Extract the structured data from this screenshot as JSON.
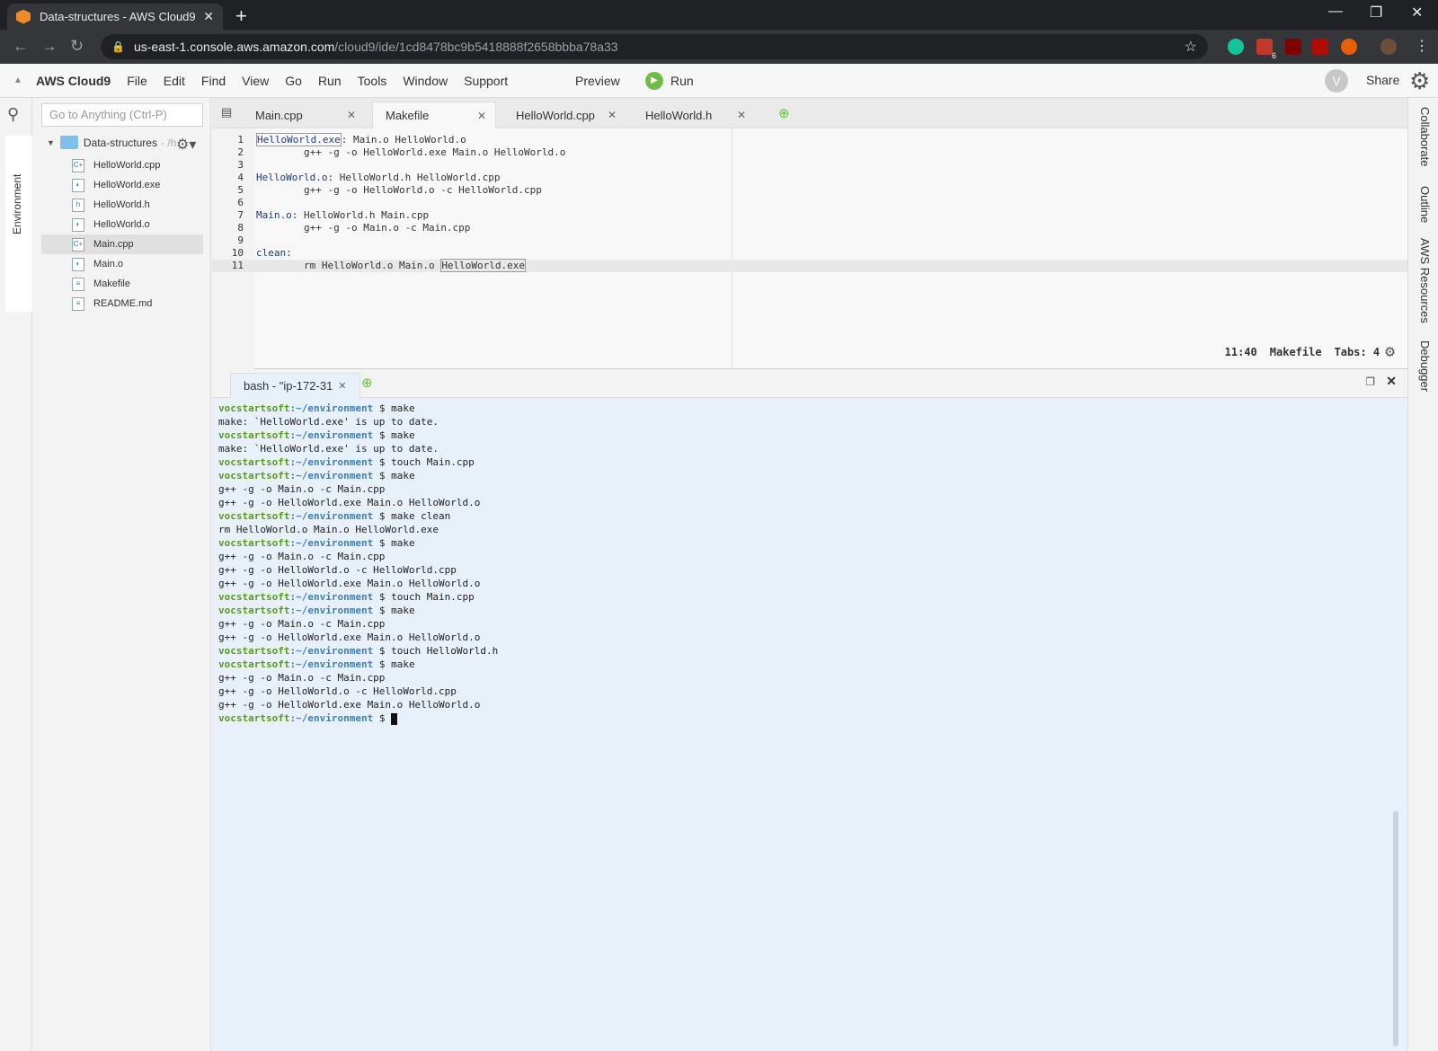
{
  "browser": {
    "tab_title": "Data-structures - AWS Cloud9",
    "new_tab": "+",
    "url_host": "us-east-1.console.aws.amazon.com",
    "url_path": "/cloud9/ide/1cd8478bc9b5418888f2658bbba78a33",
    "ext_badge": "6"
  },
  "menubar": {
    "brand": "AWS Cloud9",
    "items": [
      "File",
      "Edit",
      "Find",
      "View",
      "Go",
      "Run",
      "Tools",
      "Window",
      "Support"
    ],
    "preview": "Preview",
    "run": "Run",
    "avatar": "V",
    "share": "Share"
  },
  "left": {
    "environment_label": "Environment",
    "goto_placeholder": "Go to Anything (Ctrl-P)"
  },
  "tree": {
    "root": "Data-structures",
    "root_suffix": "- /h",
    "files": [
      {
        "name": "HelloWorld.cpp",
        "icon": "C+"
      },
      {
        "name": "HelloWorld.exe",
        "icon": "◐"
      },
      {
        "name": "HelloWorld.h",
        "icon": "h"
      },
      {
        "name": "HelloWorld.o",
        "icon": "◐"
      },
      {
        "name": "Main.cpp",
        "icon": "C+"
      },
      {
        "name": "Main.o",
        "icon": "◐"
      },
      {
        "name": "Makefile",
        "icon": "≡"
      },
      {
        "name": "README.md",
        "icon": "≡"
      }
    ],
    "selected": "Main.cpp"
  },
  "editor_tabs": [
    "Main.cpp",
    "Makefile",
    "HelloWorld.cpp",
    "HelloWorld.h"
  ],
  "active_editor_tab": "Makefile",
  "code": {
    "line_numbers": [
      "1",
      "2",
      "3",
      "4",
      "5",
      "6",
      "7",
      "8",
      "9",
      "10",
      "11"
    ],
    "l1_target": "HelloWorld.exe",
    "l1_rest": ": Main.o HelloWorld.o",
    "l2": "        g++ -g -o HelloWorld.exe Main.o HelloWorld.o",
    "l3": "",
    "l4_target": "HelloWorld.o",
    "l4_rest": ": HelloWorld.h HelloWorld.cpp",
    "l5": "        g++ -g -o HelloWorld.o -c HelloWorld.cpp",
    "l6": "",
    "l7_target": "Main.o",
    "l7_rest": ": HelloWorld.h Main.cpp",
    "l8": "        g++ -g -o Main.o -c Main.cpp",
    "l9": "",
    "l10_target": "clean",
    "l10_rest": ":",
    "l11_a": "        rm HelloWorld.o Main.o ",
    "l11_b": "HelloWorld.exe"
  },
  "status": {
    "position": "11:40",
    "mode": "Makefile",
    "tabs": "Tabs: 4"
  },
  "terminal_tab": "bash - \"ip-172-31",
  "terminal": {
    "user": "vocstartsoft",
    "path": ":~/environment",
    "lines": [
      {
        "p": true,
        "t": " $ make"
      },
      {
        "p": false,
        "t": "make: `HelloWorld.exe' is up to date."
      },
      {
        "p": true,
        "t": " $ make"
      },
      {
        "p": false,
        "t": "make: `HelloWorld.exe' is up to date."
      },
      {
        "p": true,
        "t": " $ touch Main.cpp"
      },
      {
        "p": true,
        "t": " $ make"
      },
      {
        "p": false,
        "t": "g++ -g -o Main.o -c Main.cpp"
      },
      {
        "p": false,
        "t": "g++ -g -o HelloWorld.exe Main.o HelloWorld.o"
      },
      {
        "p": true,
        "t": " $ make clean"
      },
      {
        "p": false,
        "t": "rm HelloWorld.o Main.o HelloWorld.exe"
      },
      {
        "p": true,
        "t": " $ make"
      },
      {
        "p": false,
        "t": "g++ -g -o Main.o -c Main.cpp"
      },
      {
        "p": false,
        "t": "g++ -g -o HelloWorld.o -c HelloWorld.cpp"
      },
      {
        "p": false,
        "t": "g++ -g -o HelloWorld.exe Main.o HelloWorld.o"
      },
      {
        "p": true,
        "t": " $ touch Main.cpp"
      },
      {
        "p": true,
        "t": " $ make"
      },
      {
        "p": false,
        "t": "g++ -g -o Main.o -c Main.cpp"
      },
      {
        "p": false,
        "t": "g++ -g -o HelloWorld.exe Main.o HelloWorld.o"
      },
      {
        "p": true,
        "t": " $ touch HelloWorld.h"
      },
      {
        "p": true,
        "t": " $ make"
      },
      {
        "p": false,
        "t": "g++ -g -o Main.o -c Main.cpp"
      },
      {
        "p": false,
        "t": "g++ -g -o HelloWorld.o -c HelloWorld.cpp"
      },
      {
        "p": false,
        "t": "g++ -g -o HelloWorld.exe Main.o HelloWorld.o"
      }
    ],
    "last_prompt": " $ "
  },
  "right": {
    "panels": [
      "Collaborate",
      "Outline",
      "AWS Resources",
      "Debugger"
    ]
  },
  "icons": {
    "back": "back-arrow-icon",
    "forward": "forward-arrow-icon",
    "reload": "reload-icon",
    "lock": "lock-icon",
    "star": "star-icon",
    "search": "search-icon",
    "settings": "gear-icon",
    "run": "play-icon"
  },
  "colors": {
    "run_green": "#6cbe45",
    "aws_orange": "#f28b25",
    "prompt_user": "#5a9a1c",
    "prompt_path": "#3b7fb8",
    "terminal_bg": "#e8f0f9"
  }
}
